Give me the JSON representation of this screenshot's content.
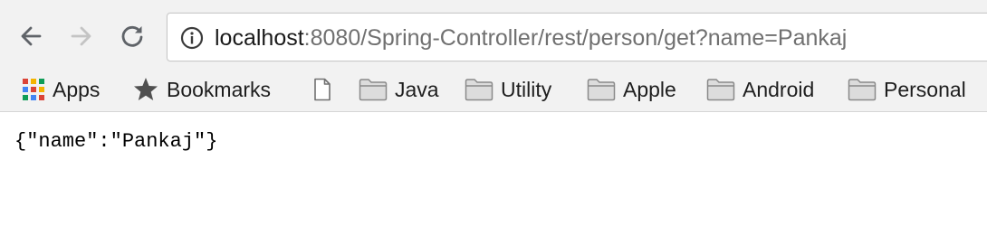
{
  "browser": {
    "nav": {
      "back_icon": "back-arrow-icon",
      "forward_icon": "forward-arrow-icon",
      "reload_icon": "reload-icon"
    },
    "address_bar": {
      "security_icon": "info-icon",
      "url_host": "localhost",
      "url_rest": ":8080/Spring-Controller/rest/person/get?name=Pankaj"
    },
    "bookmarks_bar": {
      "items": [
        {
          "label": "Apps",
          "icon": "apps-grid-icon"
        },
        {
          "label": "Bookmarks",
          "icon": "star-icon"
        },
        {
          "label": "",
          "icon": "page-icon"
        },
        {
          "label": "Java",
          "icon": "folder-icon"
        },
        {
          "label": "Utility",
          "icon": "folder-icon"
        },
        {
          "label": "Apple",
          "icon": "folder-icon"
        },
        {
          "label": "Android",
          "icon": "folder-icon"
        },
        {
          "label": "Personal",
          "icon": "folder-icon"
        }
      ]
    }
  },
  "page": {
    "body_text": "{\"name\":\"Pankaj\"}"
  },
  "colors": {
    "toolbar_bg": "#f2f2f2",
    "url_host": "#1a1a1a",
    "url_path": "#707070",
    "icon_gray": "#5f6368",
    "folder_gray": "#8a8a8a"
  }
}
